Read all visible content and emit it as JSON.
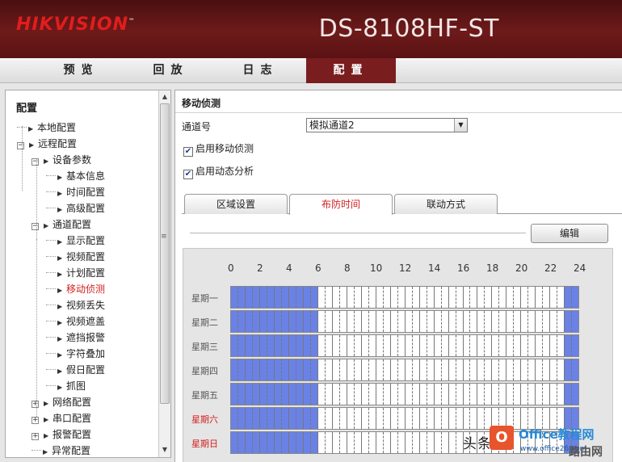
{
  "header": {
    "logo": "HIKVISION",
    "model": "DS-8108HF-ST"
  },
  "nav": [
    {
      "label": "预览",
      "active": false
    },
    {
      "label": "回放",
      "active": false
    },
    {
      "label": "日志",
      "active": false
    },
    {
      "label": "配置",
      "active": true
    }
  ],
  "sidebar": {
    "title": "配置",
    "items": [
      {
        "label": "本地配置",
        "level": 0,
        "kind": "leaf"
      },
      {
        "label": "远程配置",
        "level": 0,
        "kind": "minus"
      },
      {
        "label": "设备参数",
        "level": 1,
        "kind": "minus"
      },
      {
        "label": "基本信息",
        "level": 2,
        "kind": "leaf"
      },
      {
        "label": "时间配置",
        "level": 2,
        "kind": "leaf"
      },
      {
        "label": "高级配置",
        "level": 2,
        "kind": "leaf"
      },
      {
        "label": "通道配置",
        "level": 1,
        "kind": "minus"
      },
      {
        "label": "显示配置",
        "level": 2,
        "kind": "leaf"
      },
      {
        "label": "视频配置",
        "level": 2,
        "kind": "leaf"
      },
      {
        "label": "计划配置",
        "level": 2,
        "kind": "leaf"
      },
      {
        "label": "移动侦测",
        "level": 2,
        "kind": "leaf",
        "selected": true
      },
      {
        "label": "视频丢失",
        "level": 2,
        "kind": "leaf"
      },
      {
        "label": "视频遮盖",
        "level": 2,
        "kind": "leaf"
      },
      {
        "label": "遮挡报警",
        "level": 2,
        "kind": "leaf"
      },
      {
        "label": "字符叠加",
        "level": 2,
        "kind": "leaf"
      },
      {
        "label": "假日配置",
        "level": 2,
        "kind": "leaf"
      },
      {
        "label": "抓图",
        "level": 2,
        "kind": "leaf"
      },
      {
        "label": "网络配置",
        "level": 1,
        "kind": "plus"
      },
      {
        "label": "串口配置",
        "level": 1,
        "kind": "plus"
      },
      {
        "label": "报警配置",
        "level": 1,
        "kind": "plus"
      },
      {
        "label": "异常配置",
        "level": 1,
        "kind": "leaf"
      }
    ]
  },
  "main": {
    "title": "移动侦测",
    "channel_label": "通道号",
    "channel_value": "模拟通道2",
    "enable_motion": {
      "label": "启用移动侦测",
      "checked": true
    },
    "enable_dynamic": {
      "label": "启用动态分析",
      "checked": true
    },
    "tabs": [
      {
        "label": "区域设置",
        "active": false
      },
      {
        "label": "布防时间",
        "active": true
      },
      {
        "label": "联动方式",
        "active": false
      }
    ],
    "edit_label": "编辑"
  },
  "schedule": {
    "hour_labels": [
      "0",
      "2",
      "4",
      "6",
      "8",
      "10",
      "12",
      "14",
      "16",
      "18",
      "20",
      "22",
      "24"
    ],
    "days": [
      {
        "label": "星期一",
        "weekend": false
      },
      {
        "label": "星期二",
        "weekend": false
      },
      {
        "label": "星期三",
        "weekend": false
      },
      {
        "label": "星期四",
        "weekend": false
      },
      {
        "label": "星期五",
        "weekend": false
      },
      {
        "label": "星期六",
        "weekend": true
      },
      {
        "label": "星期日",
        "weekend": true
      }
    ],
    "armed_ranges_hours": [
      [
        0,
        6
      ],
      [
        23,
        24
      ]
    ],
    "armed_color": "#6a82e6"
  },
  "watermark": {
    "text": "头条",
    "badge": "O",
    "brand": "Office教程网",
    "url": "www.office26.com",
    "site": "路由网"
  }
}
